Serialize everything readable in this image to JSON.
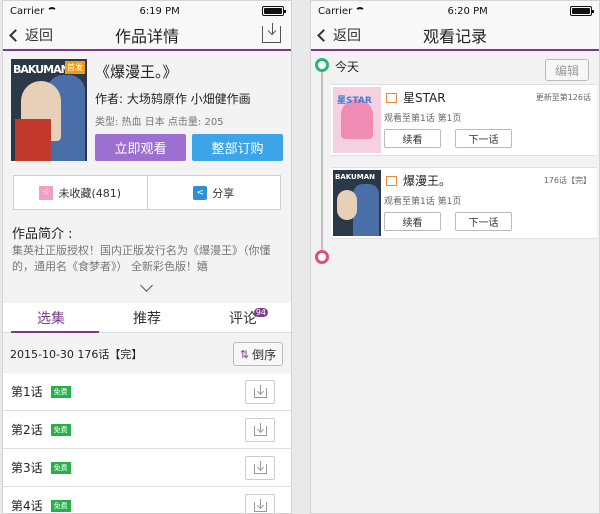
{
  "left": {
    "status": {
      "carrier": "Carrier",
      "time": "6:19 PM"
    },
    "nav": {
      "back": "返回",
      "title": "作品详情"
    },
    "comic": {
      "cover_title": "BAKUMAN",
      "cover_badge": "首发",
      "title": "《爆漫王。》",
      "author": "作者: 大场鸫原作 小畑健作画",
      "meta": "类型: 热血 日本 点击量: 205"
    },
    "buttons": {
      "watch": "立即观看",
      "subscribe": "整部订购"
    },
    "favorite": "未收藏(481)",
    "share": "分享",
    "intro": {
      "title": "作品简介 :",
      "text": "集英社正版授权！国内正版发行名为《爆漫王》（你懂的，通用名《食梦者》） 全新彩色版！嬉"
    },
    "tabs": [
      {
        "label": "选集"
      },
      {
        "label": "推荐"
      },
      {
        "label": "评论",
        "count": "94"
      }
    ],
    "sort": {
      "info": "2015-10-30 176话【完】",
      "button": "倒序"
    },
    "chapters": [
      {
        "name": "第1话",
        "tag": "免费"
      },
      {
        "name": "第2话",
        "tag": "免费"
      },
      {
        "name": "第3话",
        "tag": "免费"
      },
      {
        "name": "第4话",
        "tag": "免费"
      }
    ]
  },
  "right": {
    "status": {
      "carrier": "Carrier",
      "time": "6:20 PM"
    },
    "nav": {
      "back": "返回",
      "title": "观看记录"
    },
    "edit": "编辑",
    "today": "今天",
    "history": [
      {
        "thumb_text": "星STAR",
        "name": "星STAR",
        "status": "更新至第126话",
        "progress": "观看至第1话 第1页",
        "continue": "续看",
        "next": "下一话"
      },
      {
        "thumb_text": "BAKUMAN",
        "name": "爆漫王。",
        "status": "176话【完】",
        "progress": "观看至第1话 第1页",
        "continue": "续看",
        "next": "下一话"
      }
    ]
  },
  "colors": {
    "accent": "#7b3b8c",
    "watch": "#9c6fd0",
    "subscribe": "#3ca4e8",
    "free": "#26b04a"
  }
}
